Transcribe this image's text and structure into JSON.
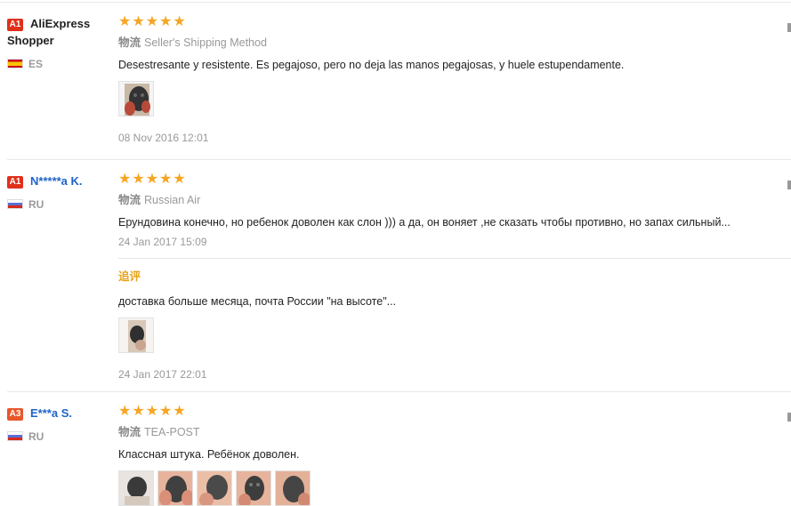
{
  "shipping_prefix": "物流",
  "stars": "★★★★★",
  "reviews": [
    {
      "badge": "A1",
      "name": "AliExpress Shopper",
      "name_line1": "AliExpress",
      "name_line2": "Shopper",
      "country": "ES",
      "shipping": "Seller's Shipping Method",
      "text": "Desestresante y resistente. Es pegajoso, pero no deja las manos pegajosas, y huele estupendamente.",
      "date": "08 Nov 2016 12:01"
    },
    {
      "badge": "A1",
      "name": "N*****a K.",
      "country": "RU",
      "shipping": "Russian Air",
      "text": "Ерундовина конечно, но ребенок доволен как слон ))) а да, он воняет ,не сказать чтобы противно, но запах сильный...",
      "date": "24 Jan 2017 15:09",
      "followup": {
        "label": "追评",
        "text": "доставка больше месяца, почта России \"на высоте\"...",
        "date": "24 Jan 2017 22:01"
      }
    },
    {
      "badge": "A3",
      "name": "E***a S.",
      "country": "RU",
      "shipping": "TEA-POST",
      "text": "Классная штука. Ребёнок доволен."
    }
  ]
}
